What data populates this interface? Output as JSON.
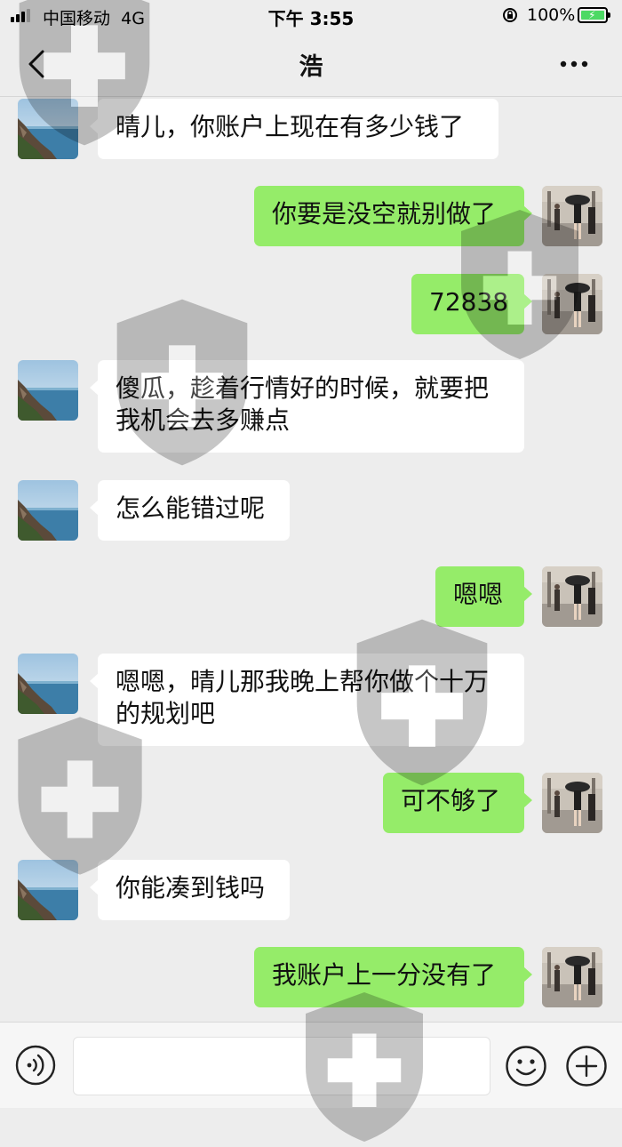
{
  "status_bar": {
    "carrier": "中国移动",
    "network": "4G",
    "time": "下午 3:55",
    "battery_percent": "100%",
    "battery_level": 1.0,
    "icons": [
      "signal-icon",
      "orientation-lock-icon",
      "battery-charging-icon"
    ]
  },
  "nav": {
    "title": "浩",
    "back_icon": "chevron-left-icon",
    "more_icon": "more-dots-icon"
  },
  "messages": [
    {
      "side": "in",
      "text": "晴儿，你账户上现在有多少钱了"
    },
    {
      "side": "out",
      "text": "你要是没空就别做了"
    },
    {
      "side": "out",
      "text": "72838"
    },
    {
      "side": "in",
      "text": "傻瓜，趁着行情好的时候，就要把我机会去多赚点"
    },
    {
      "side": "in",
      "text": "怎么能错过呢"
    },
    {
      "side": "out",
      "text": "嗯嗯"
    },
    {
      "side": "in",
      "text": "嗯嗯，晴儿那我晚上帮你做个十万的规划吧"
    },
    {
      "side": "out",
      "text": "可不够了"
    },
    {
      "side": "in",
      "text": "你能凑到钱吗"
    },
    {
      "side": "out",
      "text": "我账户上一分没有了"
    }
  ],
  "input_bar": {
    "value": "",
    "icons": [
      "voice-icon",
      "emoji-icon",
      "add-icon"
    ]
  },
  "colors": {
    "background": "#ededed",
    "incoming_bubble": "#ffffff",
    "outgoing_bubble": "#95ec69",
    "battery": "#4cd964"
  }
}
